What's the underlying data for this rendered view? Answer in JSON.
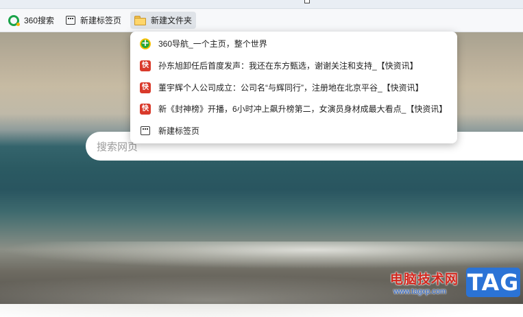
{
  "bookmarks_bar": {
    "items": [
      {
        "label": "360搜索",
        "icon": "360-search-icon"
      },
      {
        "label": "新建标签页",
        "icon": "tab-icon"
      },
      {
        "label": "新建文件夹",
        "icon": "folder-icon",
        "active": true
      }
    ]
  },
  "folder_menu": {
    "items": [
      {
        "label": "360导航_一个主页，整个世界",
        "icon": "360-nav-icon"
      },
      {
        "label": "孙东旭卸任后首度发声：我还在东方甄选，谢谢关注和支持_【快资讯】",
        "icon": "kuai-icon",
        "icon_text": "快"
      },
      {
        "label": "董宇辉个人公司成立：公司名“与辉同行”，注册地在北京平谷_【快资讯】",
        "icon": "kuai-icon",
        "icon_text": "快"
      },
      {
        "label": "新《封神榜》开播，6小时冲上飙升榜第二，女演员身材成最大看点_【快资讯】",
        "icon": "kuai-icon",
        "icon_text": "快"
      },
      {
        "label": "新建标签页",
        "icon": "tab-icon"
      }
    ]
  },
  "search": {
    "placeholder": "搜索网页"
  },
  "watermark": {
    "site_cn": "电脑技术网",
    "url": "www.tagxp.com",
    "logo": "TAG"
  },
  "colors": {
    "folder_active_bg": "#dfe3e8",
    "kuai_red": "#d93a2b",
    "watermark_blue": "#2b73d6"
  }
}
